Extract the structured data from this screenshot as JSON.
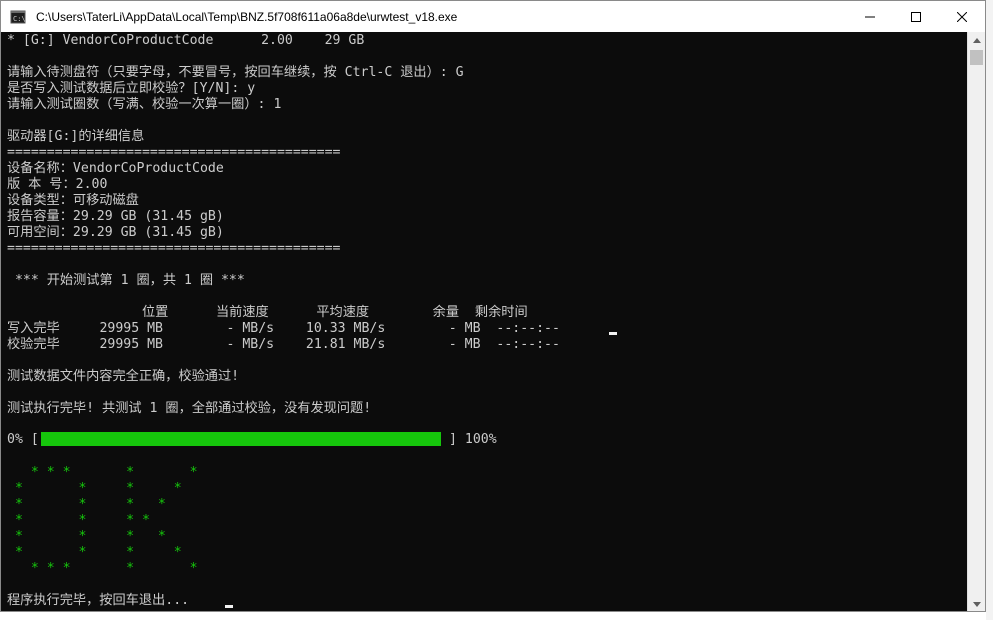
{
  "window": {
    "title": "C:\\Users\\TaterLi\\AppData\\Local\\Temp\\BNZ.5f708f611a06a8de\\urwtest_v18.exe"
  },
  "console": {
    "lines": [
      "* [G:] VendorCoProductCode      2.00    29 GB",
      "",
      "请输入待测盘符（只要字母，不要冒号，按回车继续，按 Ctrl-C 退出）: G",
      "是否写入测试数据后立即校验？[Y/N]: y",
      "请输入测试圈数（写满、校验一次算一圈）: 1",
      "",
      "驱动器[G:]的详细信息",
      "==========================================",
      "设备名称：VendorCoProductCode",
      "版 本 号：2.00",
      "设备类型：可移动磁盘",
      "报告容量：29.29 GB (31.45 gB)",
      "可用空间：29.29 GB (31.45 gB)",
      "==========================================",
      "",
      " *** 开始测试第 1 圈，共 1 圈 ***",
      "",
      "                 位置      当前速度      平均速度        余量  剩余时间",
      "写入完毕     29995 MB        - MB/s    10.33 MB/s        - MB  --:--:--",
      "校验完毕     29995 MB        - MB/s    21.81 MB/s        - MB  --:--:--",
      "",
      "测试数据文件内容完全正确，校验通过!",
      "",
      "测试执行完毕! 共测试 1 圈，全部通过校验，没有发现问题!",
      ""
    ],
    "progress": {
      "left": "0% [",
      "right": "] 100%",
      "percent": 100
    },
    "ok_art": [
      "   * * *       *       *",
      " *       *     *     *",
      " *       *     *   *",
      " *       *     * *",
      " *       *     *   *",
      " *       *     *     *",
      "   * * *       *       *"
    ],
    "exit_prompt": "程序执行完毕，按回车退出..."
  },
  "colors": {
    "console_bg": "#0c0c0c",
    "console_fg": "#cccccc",
    "progress_green": "#16c60c"
  },
  "icons": {
    "app": "console-app-icon",
    "minimize": "minimize-icon",
    "maximize": "maximize-icon",
    "close": "close-icon"
  }
}
